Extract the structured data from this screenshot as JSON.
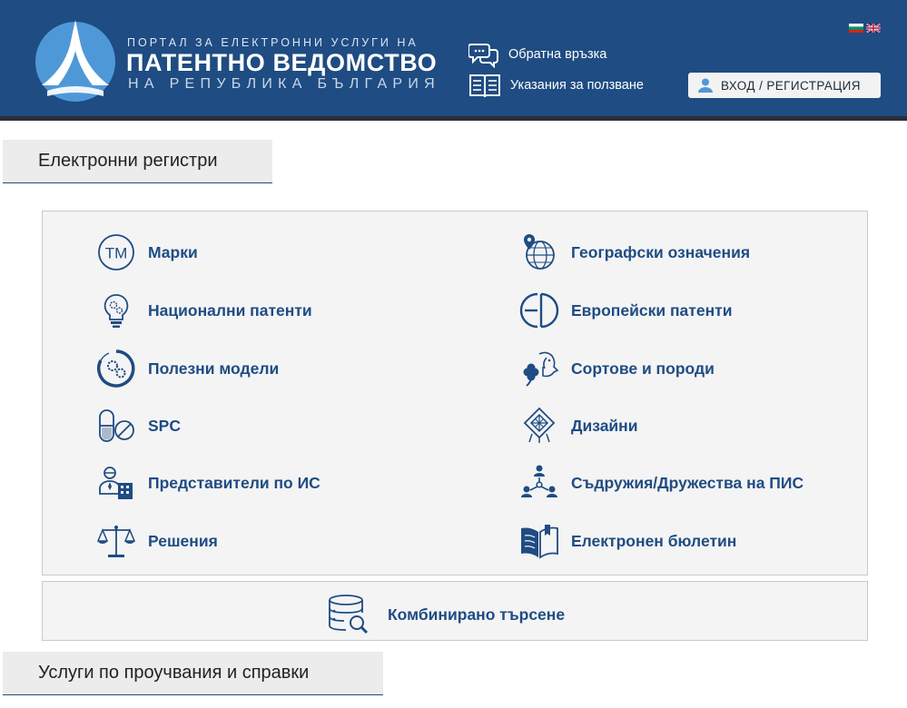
{
  "header": {
    "brand_line1": "ПОРТАЛ ЗА ЕЛЕКТРОННИ УСЛУГИ НА",
    "brand_line2": "ПАТЕНТНО ВЕДОМСТВО",
    "brand_line3": "НА РЕПУБЛИКА БЪЛГАРИЯ",
    "feedback_label": "Обратна връзка",
    "guide_label": "Указания за ползване",
    "login_label": "ВХОД / РЕГИСТРАЦИЯ",
    "languages": [
      "bg-flag-icon",
      "uk-flag-icon"
    ]
  },
  "sections": {
    "registers_title": "Електронни регистри",
    "services_title": "Услуги по проучвания и справки"
  },
  "registers": {
    "left": [
      {
        "label": "Марки",
        "icon": "trademark-icon"
      },
      {
        "label": "Национални патенти",
        "icon": "lightbulb-gears-icon"
      },
      {
        "label": "Полезни модели",
        "icon": "gears-circle-icon"
      },
      {
        "label": "SPC",
        "icon": "pill-icon"
      },
      {
        "label": "Представители по ИС",
        "icon": "representative-icon"
      },
      {
        "label": "Решения",
        "icon": "scales-icon"
      }
    ],
    "right": [
      {
        "label": "Географски означения",
        "icon": "globe-pin-icon"
      },
      {
        "label": "Европейски патенти",
        "icon": "ep-logo-icon"
      },
      {
        "label": "Сортове и породи",
        "icon": "clover-dog-icon"
      },
      {
        "label": "Дизайни",
        "icon": "design-diamond-icon"
      },
      {
        "label": "Съдружия/Дружества на ПИС",
        "icon": "network-people-icon"
      },
      {
        "label": "Електронен бюлетин",
        "icon": "open-book-icon"
      }
    ]
  },
  "combined_search": {
    "label": "Комбинирано търсене",
    "icon": "database-search-icon"
  },
  "colors": {
    "header_bg": "#1f4c82",
    "link_text": "#1f4c82",
    "panel_bg": "#f4f4f5"
  }
}
